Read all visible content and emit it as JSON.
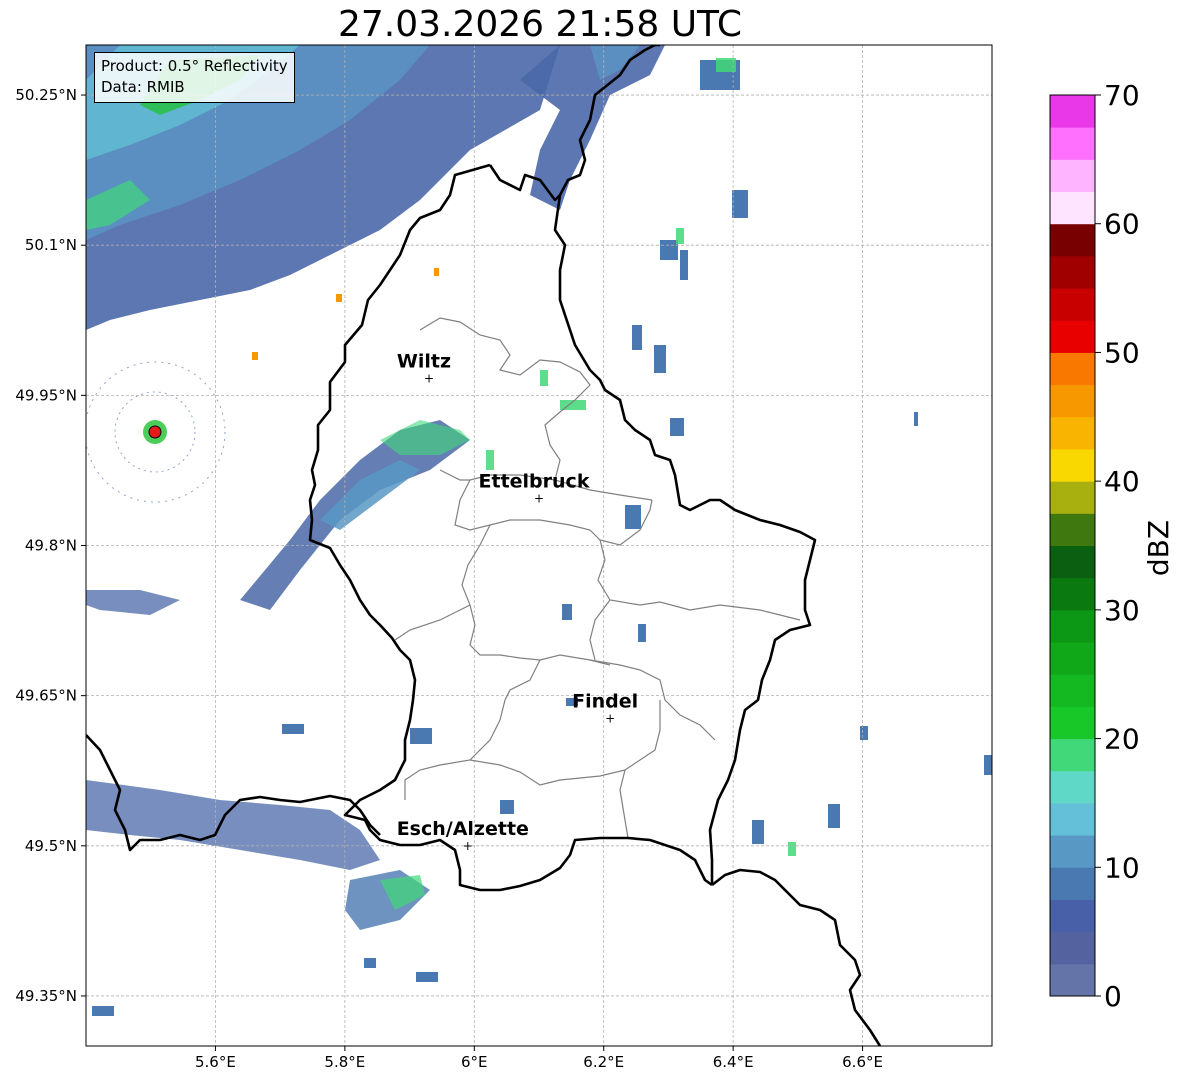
{
  "title": "27.03.2026 21:58 UTC",
  "info": {
    "product_line": "Product: 0.5° Reflectivity",
    "data_line": "Data: RMIB"
  },
  "map": {
    "lon_range": [
      5.4,
      6.8
    ],
    "lat_range": [
      49.3,
      50.3
    ],
    "lon_ticks": [
      "5.6°E",
      "5.8°E",
      "6°E",
      "6.2°E",
      "6.4°E",
      "6.6°E"
    ],
    "lat_ticks": [
      "49.35°N",
      "49.5°N",
      "49.65°N",
      "49.8°N",
      "49.95°N",
      "50.1°N",
      "50.25°N"
    ],
    "grid": true,
    "radar_site_color": "#e8191a",
    "cities": [
      {
        "name": "Wiltz",
        "lon": 5.93,
        "lat": 49.967
      },
      {
        "name": "Ettelbruck",
        "lon": 6.1,
        "lat": 49.847
      },
      {
        "name": "Findel",
        "lon": 6.21,
        "lat": 49.627
      },
      {
        "name": "Esch/Alzette",
        "lon": 5.99,
        "lat": 49.5
      }
    ]
  },
  "colorbar": {
    "label": "dBZ",
    "ticks": [
      "0",
      "10",
      "20",
      "30",
      "40",
      "50",
      "60",
      "70"
    ],
    "colors": [
      "#6474a8",
      "#5462a0",
      "#4860a8",
      "#4a78b0",
      "#5898c4",
      "#64c0d8",
      "#60d8c8",
      "#40d878",
      "#18c828",
      "#14b820",
      "#10a818",
      "#0c9814",
      "#0a7a10",
      "#0a6010",
      "#407810",
      "#a8b010",
      "#f8d800",
      "#f8b400",
      "#f89800",
      "#f87800",
      "#e80000",
      "#c80000",
      "#a00000",
      "#780000",
      "#ffe4ff",
      "#ffb4ff",
      "#ff70ff",
      "#e838e8"
    ]
  }
}
